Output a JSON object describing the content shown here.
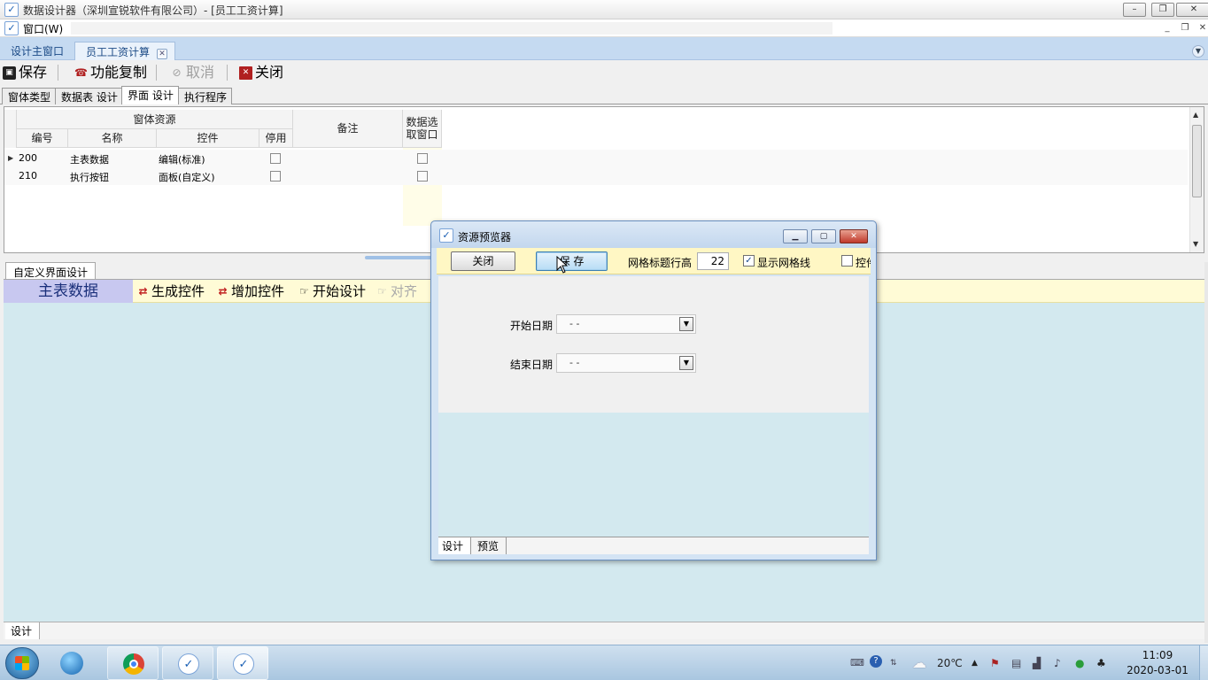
{
  "window": {
    "title": "数据设计器（深圳宣锐软件有限公司）- [员工工资计算]",
    "controls": [
      "–",
      "❐",
      "✕"
    ]
  },
  "menu": {
    "window_label": "窗口(W)"
  },
  "doc_tabs": [
    {
      "label": "设计主窗口",
      "active": false
    },
    {
      "label": "员工工资计算",
      "active": true
    }
  ],
  "toolbar": {
    "save": "保存",
    "copy": "功能复制",
    "cancel": "取消",
    "close": "关闭"
  },
  "inner_tabs": [
    "窗体类型",
    "数据表 设计",
    "界面 设计",
    "执行程序"
  ],
  "grid": {
    "group_header": "窗体资源",
    "columns": [
      "编号",
      "名称",
      "控件",
      "停用"
    ],
    "remark_header": "备注",
    "select_header_line1": "数据选",
    "select_header_line2": "取窗口",
    "rows": [
      {
        "id": "200",
        "name": "主表数据",
        "control": "编辑(标准)",
        "disabled": false,
        "select": false,
        "current": true
      },
      {
        "id": "210",
        "name": "执行按钮",
        "control": "面板(自定义)",
        "disabled": false,
        "select": false,
        "current": false
      }
    ]
  },
  "lower": {
    "tab_label": "自定义界面设计",
    "main_title": "主表数据",
    "generate": "生成控件",
    "add": "增加控件",
    "start": "开始设计",
    "align": "对齐",
    "status_tab": "设计"
  },
  "dialog": {
    "title": "资源预览器",
    "close_btn": "关闭",
    "save_btn": "保 存",
    "grid_row_height_label": "网格标题行高",
    "grid_row_height_value": "22",
    "show_grid_label": "显示网格线",
    "show_grid_checked": true,
    "control_label": "控件",
    "start_date_label": "开始日期",
    "start_date_value": "- -",
    "end_date_label": "结束日期",
    "end_date_value": "- -",
    "tabs": [
      "设计",
      "预览"
    ]
  },
  "taskbar": {
    "weather": "20℃",
    "time": "11:09",
    "date": "2020-03-01"
  },
  "colors": {
    "accent_tab": "#c5daf1",
    "design_bg": "#d3e9ef",
    "toolbar_yellow": "#fffbd6",
    "main_title_bg": "#c8c8f0"
  }
}
